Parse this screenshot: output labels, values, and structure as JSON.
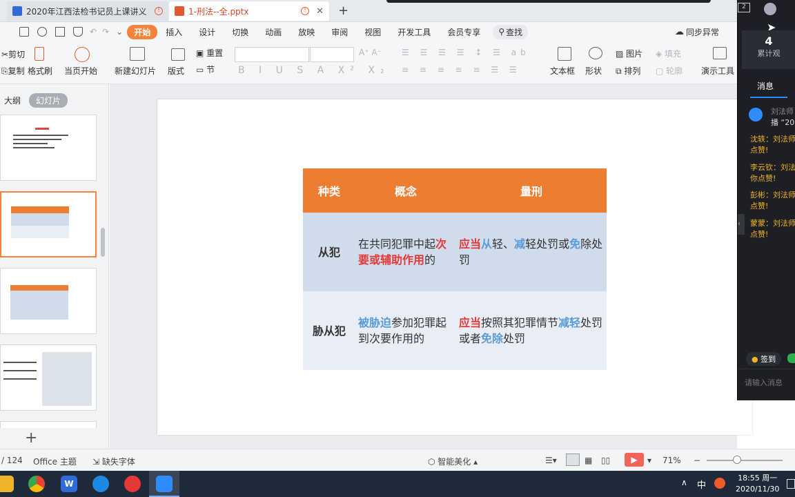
{
  "tabs": {
    "inactive_title": "2020年江西法检书记员上课讲义",
    "active_title": "1-刑法--全.pptx"
  },
  "menu": {
    "items": [
      "开始",
      "插入",
      "设计",
      "切换",
      "动画",
      "放映",
      "审阅",
      "视图",
      "开发工具",
      "会员专享"
    ],
    "search": "查找",
    "sync": "同步异常"
  },
  "ribbon": {
    "cut": "剪切",
    "copy": "复制",
    "format_painter": "格式刷",
    "from_current": "当页开始",
    "new_slide": "新建幻灯片",
    "layout": "版式",
    "reset": "重置",
    "section": "节",
    "textbox": "文本框",
    "shape": "形状",
    "picture": "图片",
    "arrange": "排列",
    "fill": "填充",
    "outline": "轮廓",
    "present_tool": "演示工具"
  },
  "left_panel": {
    "outline": "大纲",
    "slides": "幻灯片"
  },
  "slide": {
    "headers": [
      "种类",
      "概念",
      "量刑"
    ],
    "row1_kind": "从犯",
    "row1_concept_a": "在共同犯罪中起",
    "row1_concept_red": "次要或辅助作用",
    "row1_concept_b": "的",
    "row1_p1": "应当",
    "row1_p2": "从",
    "row1_p3": "轻、",
    "row1_p4": "减",
    "row1_p5": "轻处罚或",
    "row1_p6": "免",
    "row1_p7": "除处罚",
    "row2_kind": "胁从犯",
    "row2_blue": "被胁迫",
    "row2_concept_rest": "参加犯罪起到次要作用的",
    "row2_p1": "应当",
    "row2_p2": "按照其犯罪情节",
    "row2_p3": "减轻",
    "row2_p4": "处罚或者",
    "row2_p5": "免除",
    "row2_p6": "处罚"
  },
  "status": {
    "page": "/ 124",
    "theme": "Office 主题",
    "missing_font": "缺失字体",
    "beautify": "智能美化",
    "zoom": "71%"
  },
  "taskbar": {
    "time": "18:55 周一",
    "date": "2020/11/30",
    "ime": "中"
  },
  "chat": {
    "count": "4",
    "count_label": "累计观",
    "tab": "消息",
    "msg0_name": "刘法师",
    "msg0_text": "播 “20",
    "msgs": [
      {
        "a": "沈轶：刘法师",
        "b": "点赞!"
      },
      {
        "a": "李云钦：刘法",
        "b": "你点赞!"
      },
      {
        "a": "彭彬：刘法师",
        "b": "点赞!"
      },
      {
        "a": "蒙蒙：刘法师",
        "b": "点赞!"
      }
    ],
    "signin": "签到",
    "input_placeholder": "请输入消息"
  },
  "colors": {
    "accent": "#f5833c",
    "table_header": "#ed7d31",
    "table_row1": "#d0dbec",
    "table_row2": "#e9eef6",
    "red_text": "#e53935",
    "blue_text": "#5b9bd5"
  }
}
